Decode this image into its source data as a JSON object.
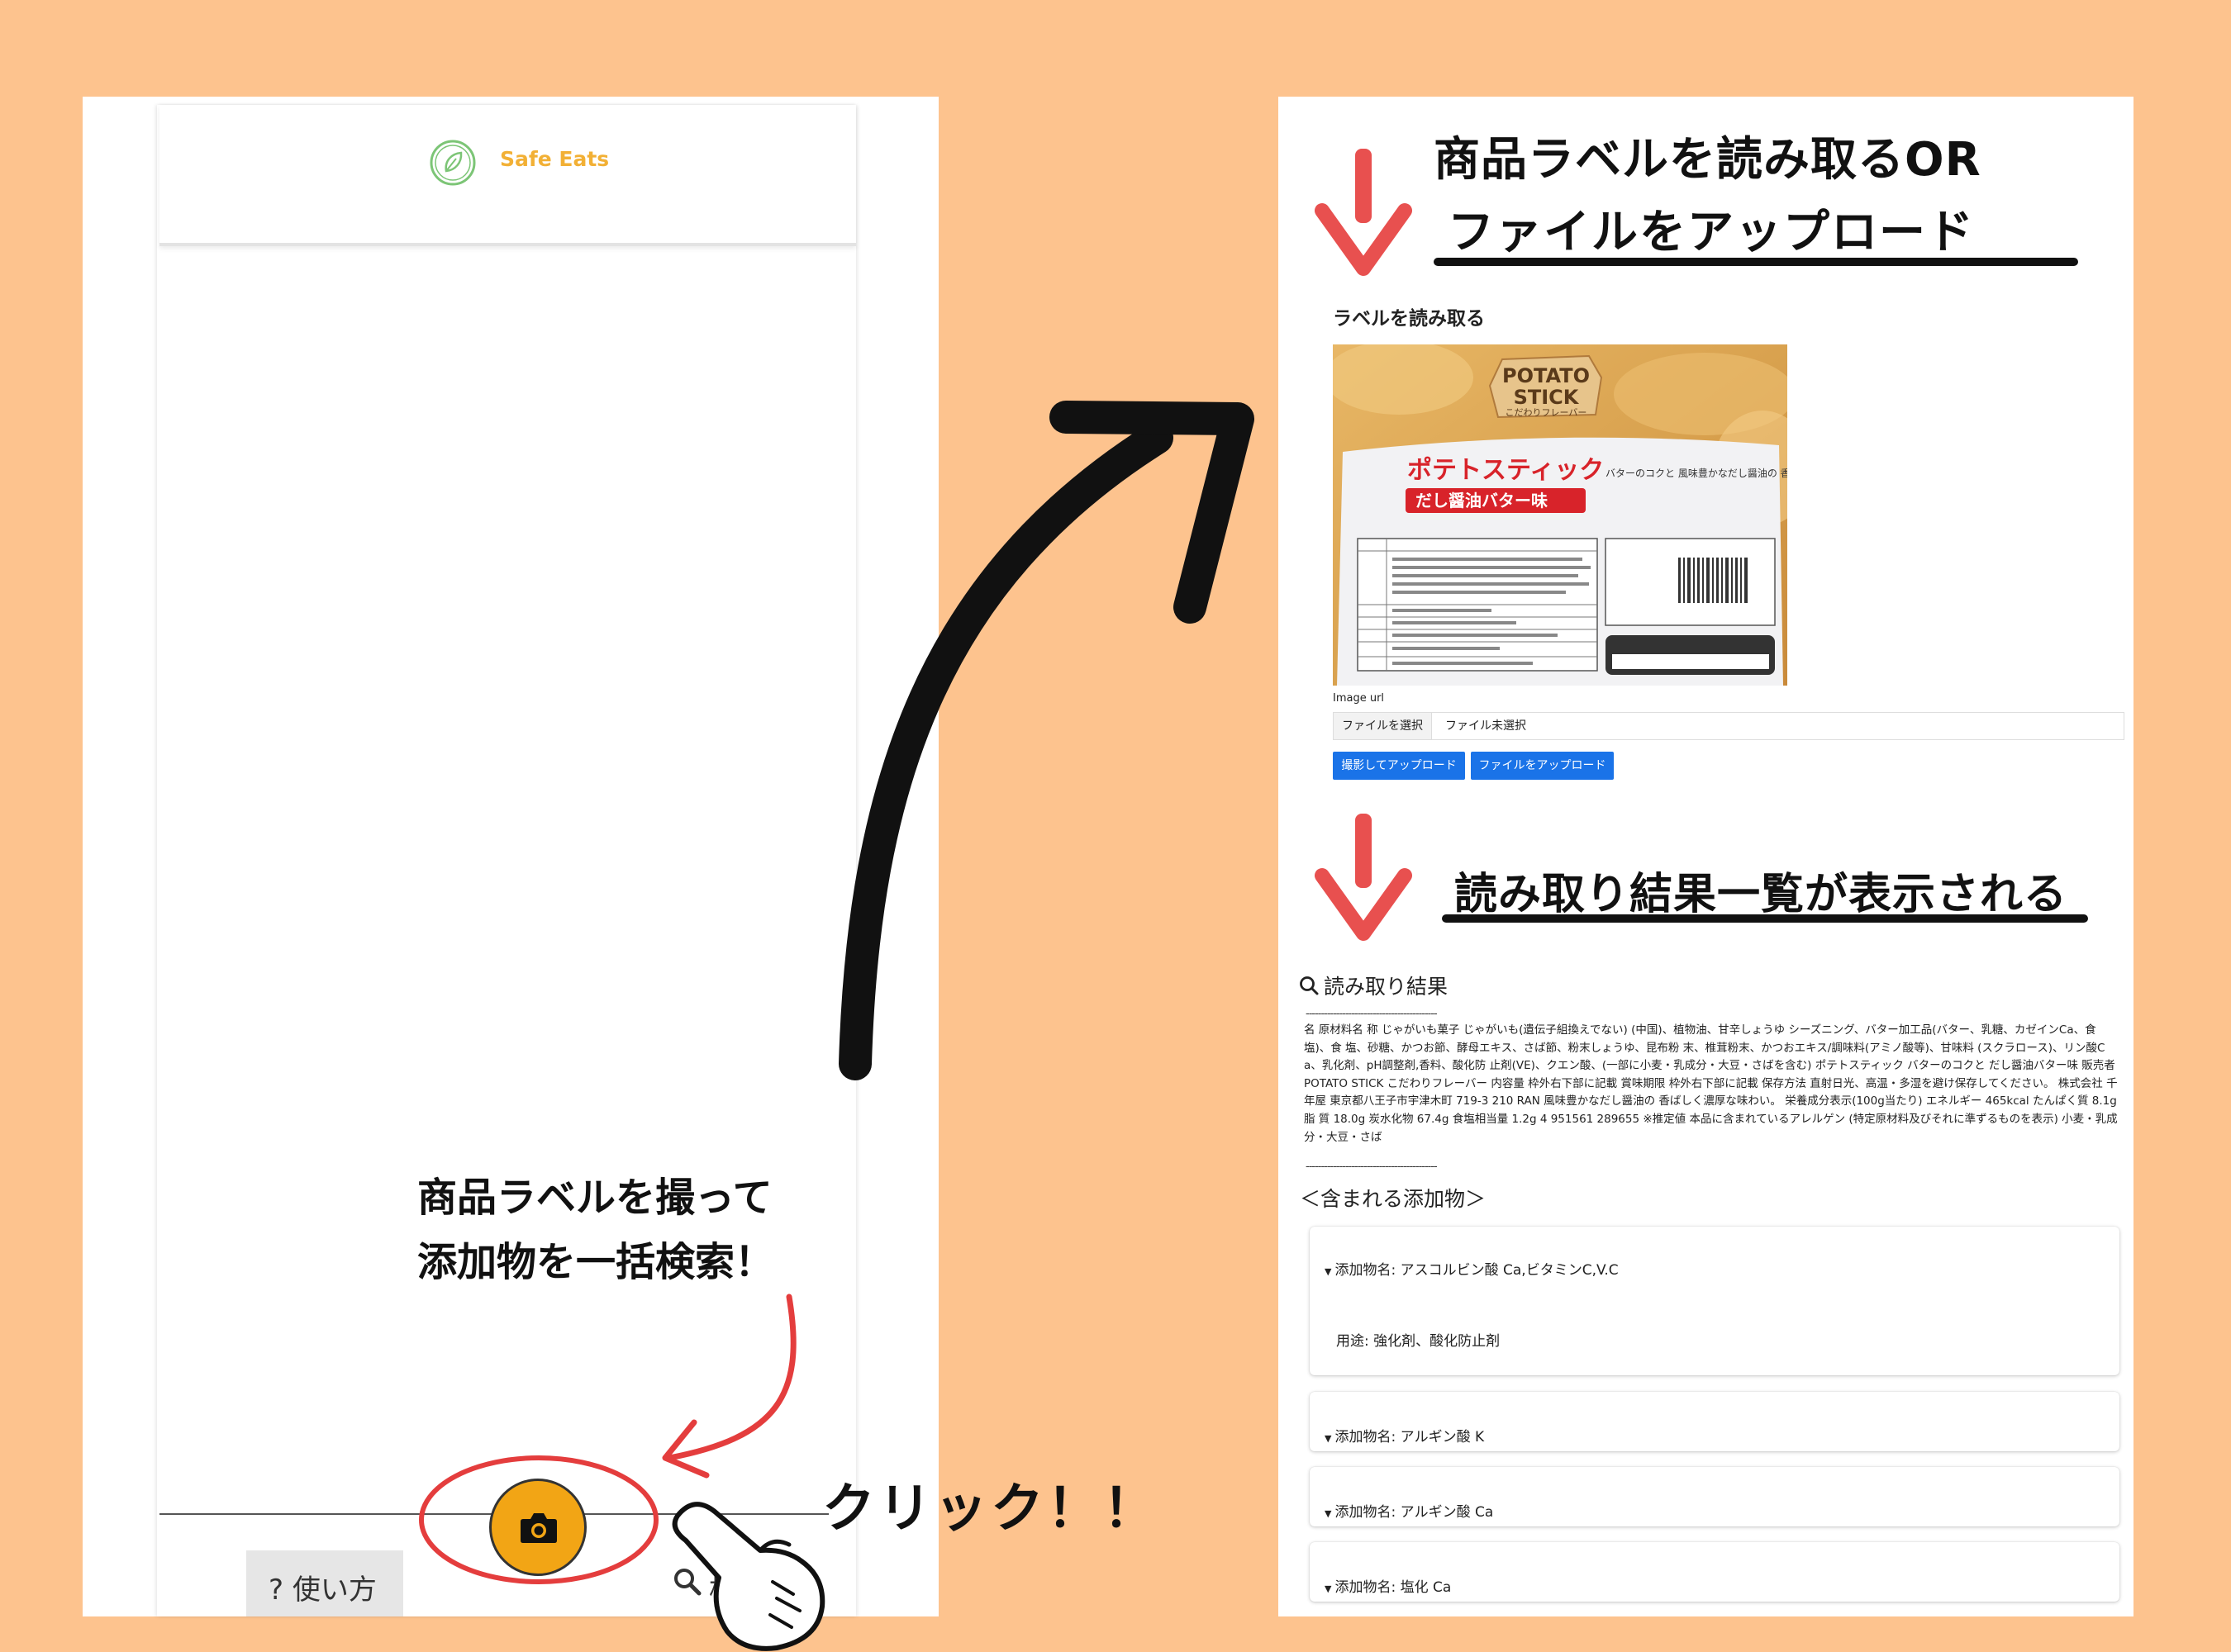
{
  "left_app": {
    "app_title": "Safe Eats",
    "help_tab_label": "使い方",
    "help_tab_prefix": "?",
    "search_tab_label": "検"
  },
  "left_annotations": {
    "caption_line_1": "商品ラベルを撮って",
    "caption_line_2": "添加物を一括検索！",
    "click_text": "クリック！！"
  },
  "right_annotations": {
    "heading_1": "商品ラベルを読み取るOR",
    "heading_2": "ファイルをアップロード",
    "heading_3": "読み取り結果一覧が表示される"
  },
  "upload": {
    "section_label": "ラベルを読み取る",
    "image_url_label": "Image url",
    "file_choose_label": "ファイルを選択",
    "file_none_label": "ファイル未選択",
    "camera_upload_button": "撮影してアップロード",
    "file_upload_button": "ファイルをアップロード",
    "image_text": {
      "brand_1": "POTATO",
      "brand_2": "STICK",
      "brand_sub": "こだわりフレーバー",
      "product_name": "ポテトスティック",
      "flavor": "だし醤油バター味",
      "tagline": "バターのコクと 風味豊かなだし醤油の 香ばしく濃厚な味わい。"
    }
  },
  "results": {
    "title": "読み取り結果",
    "divider": "-------------------------------------------",
    "ocr_text": "名 原材料名 称 じゃがいも菓子 じゃがいも(遺伝子組換えでない) (中国)、植物油、甘辛しょうゆ シーズニング、バター加工品(バター、乳糖、カゼインCa、食塩)、食 塩、砂糖、かつお節、酵母エキス、さば節、粉末しょうゆ、昆布粉 末、椎茸粉末、かつおエキス/調味料(アミノ酸等)、甘味料 (スクラロース)、リン酸Ca、乳化剤、pH調整剤,香料、酸化防 止剤(VE)、クエン酸、(一部に小麦・乳成分・大豆・さばを含む) ポテトスティック バターのコクと だし醤油バター味 販売者 POTATO STICK こだわりフレーバー 内容量 枠外右下部に記載 賞味期限 枠外右下部に記載 保存方法 直射日光、高温・多湿を避け保存してください。 株式会社 千年屋 東京都八王子市宇津木町 719-3 210 RAN 風味豊かなだし醤油の 香ばしく濃厚な味わい。 栄養成分表示(100g当たり) エネルギー 465kcal たんぱく質 8.1g 脂 質 18.0g 炭水化物 67.4g 食塩相当量 1.2g 4 951561 289655 ※推定値 本品に含まれているアレルゲン (特定原材料及びそれに準ずるものを表示) 小麦・乳成分・大豆・さば",
    "additives_title": "＜含まれる添加物＞",
    "additives": [
      {
        "name": "添加物名: アスコルビン酸 Ca,ビタミンC,V.C",
        "usage": "用途: 強化剤、酸化防止剤"
      },
      {
        "name": "添加物名: アルギン酸 K"
      },
      {
        "name": "添加物名: アルギン酸 Ca"
      },
      {
        "name": "添加物名: 塩化 Ca"
      }
    ]
  },
  "colors": {
    "background": "#FDC38E",
    "accent_orange": "#F2A515",
    "logo_text": "#F2B035",
    "logo_green": "#7CC576",
    "arrow_red": "#E8504F",
    "circle_red": "#E43D3D",
    "button_blue": "#1a73e8"
  },
  "icons": [
    "leaf-logo-icon",
    "camera-icon",
    "search-icon",
    "pointing-hand-icon",
    "down-arrow-icon",
    "curved-arrow-icon"
  ]
}
